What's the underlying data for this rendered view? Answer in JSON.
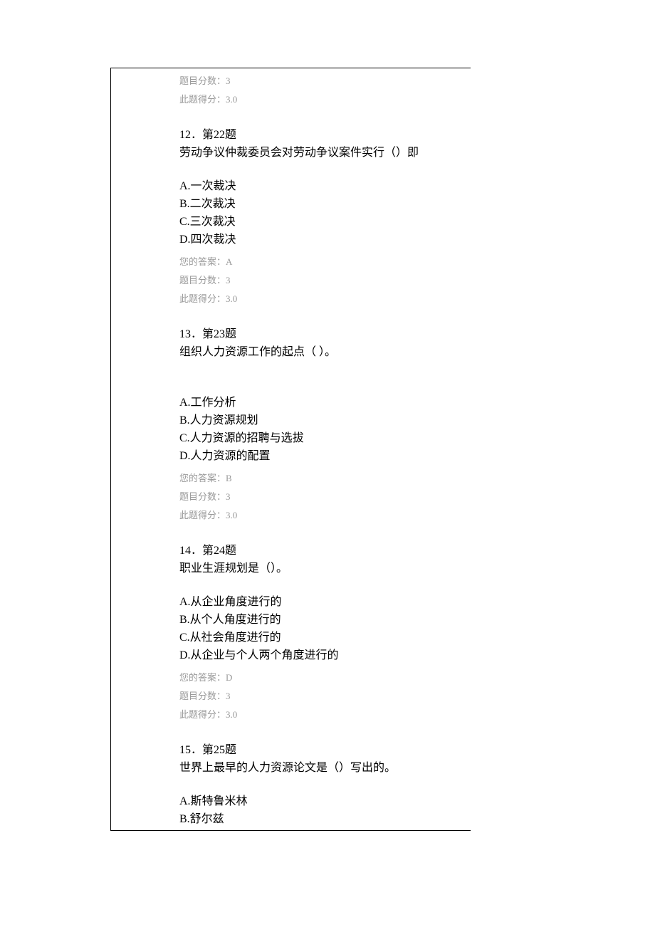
{
  "meta_labels": {
    "answer_prefix": "您的答案：",
    "score_label": "题目分数：",
    "gained_label": "此题得分："
  },
  "leading_meta": {
    "score": "3",
    "gained": "3.0"
  },
  "questions": [
    {
      "num_line": "12．第22题",
      "prompt": "劳动争议仲裁委员会对劳动争议案件实行（）即",
      "options": [
        "A.一次裁决",
        "B.二次裁决",
        "C.三次裁决",
        "D.四次裁决"
      ],
      "answer": "A",
      "score": "3",
      "gained": "3.0",
      "extra_blank": false
    },
    {
      "num_line": "13．第23题",
      "prompt": "组织人力资源工作的起点（  ）。",
      "options": [
        "A.工作分析",
        "B.人力资源规划",
        "C.人力资源的招聘与选拔",
        "D.人力资源的配置"
      ],
      "answer": "B",
      "score": "3",
      "gained": "3.0",
      "extra_blank": true
    },
    {
      "num_line": "14．第24题",
      "prompt": "职业生涯规划是（）。",
      "options": [
        "A.从企业角度进行的",
        "B.从个人角度进行的",
        "C.从社会角度进行的",
        "D.从企业与个人两个角度进行的"
      ],
      "answer": "D",
      "score": "3",
      "gained": "3.0",
      "extra_blank": false
    },
    {
      "num_line": "15．第25题",
      "prompt": "世界上最早的人力资源论文是（）写出的。",
      "options": [
        "A.斯特鲁米林",
        "B.舒尔兹"
      ],
      "answer": null,
      "score": null,
      "gained": null,
      "extra_blank": false
    }
  ]
}
